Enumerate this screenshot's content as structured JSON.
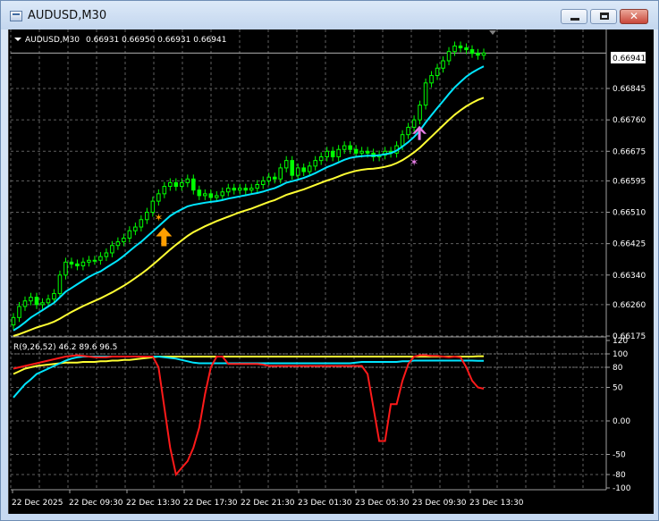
{
  "window": {
    "title": "AUDUSD,M30",
    "icon": "chart-window-icon"
  },
  "chart_header": {
    "symbol_label": "AUDUSD,M30",
    "ohlc_text": "0.66931 0.66950 0.66931 0.66941"
  },
  "indicator_label": "R(9,26,52) 46.2 89.6 96.5",
  "current_price_label": "0.66941",
  "colors": {
    "background": "#000000",
    "grid": "#606060",
    "bull_candle": "#00ff00",
    "fast_ma": "#00e5ff",
    "slow_ma": "#ffff33",
    "osc_red": "#ff1a1a",
    "osc_cyan": "#00e5ff",
    "osc_yellow": "#ffff33",
    "buy_arrow_orange": "#ff9f00",
    "buy_arrow_violet": "#e67ee6"
  },
  "chart_data": [
    {
      "type": "candlestick",
      "ylim": [
        0.66175,
        0.66995
      ],
      "price_ticks": [
        "0.66845",
        "0.66760",
        "0.66675",
        "0.66595",
        "0.66510",
        "0.66425",
        "0.66340",
        "0.66260",
        "0.66175"
      ],
      "price_tick_values": [
        0.66845,
        0.6676,
        0.66675,
        0.66595,
        0.6651,
        0.66425,
        0.6634,
        0.6626,
        0.66175
      ],
      "last_price": 0.66941,
      "time_labels": [
        "22 Dec 2025",
        "22 Dec 09:30",
        "22 Dec 13:30",
        "22 Dec 17:30",
        "22 Dec 21:30",
        "23 Dec 01:30",
        "23 Dec 05:30",
        "23 Dec 09:30",
        "23 Dec 13:30"
      ],
      "closes": [
        0.66225,
        0.66255,
        0.6627,
        0.6628,
        0.6626,
        0.66265,
        0.66275,
        0.6629,
        0.6634,
        0.66375,
        0.6637,
        0.66365,
        0.66375,
        0.6638,
        0.6638,
        0.6639,
        0.664,
        0.6642,
        0.6643,
        0.6644,
        0.6646,
        0.6647,
        0.6649,
        0.6651,
        0.6654,
        0.6656,
        0.6658,
        0.6659,
        0.6658,
        0.6659,
        0.666,
        0.6657,
        0.66555,
        0.6656,
        0.6655,
        0.66555,
        0.66565,
        0.66575,
        0.6657,
        0.66575,
        0.6657,
        0.66575,
        0.66585,
        0.66595,
        0.66605,
        0.666,
        0.6663,
        0.6665,
        0.6661,
        0.6663,
        0.6662,
        0.66635,
        0.6665,
        0.6666,
        0.66675,
        0.6666,
        0.6668,
        0.6669,
        0.6668,
        0.6667,
        0.66675,
        0.6667,
        0.6666,
        0.66665,
        0.66675,
        0.6667,
        0.6669,
        0.6672,
        0.6674,
        0.6676,
        0.668,
        0.6686,
        0.6688,
        0.669,
        0.6692,
        0.66945,
        0.6696,
        0.66955,
        0.6695,
        0.6694,
        0.66935,
        0.66941
      ],
      "fast_ma": [
        0.6619,
        0.662,
        0.66212,
        0.66225,
        0.66235,
        0.66245,
        0.66255,
        0.66265,
        0.6628,
        0.66295,
        0.66305,
        0.66315,
        0.66325,
        0.66335,
        0.66343,
        0.6635,
        0.6636,
        0.6637,
        0.6638,
        0.66392,
        0.66405,
        0.66418,
        0.6643,
        0.66444,
        0.66458,
        0.66472,
        0.66486,
        0.665,
        0.6651,
        0.66518,
        0.66526,
        0.6653,
        0.66533,
        0.66536,
        0.66538,
        0.6654,
        0.66543,
        0.66547,
        0.6655,
        0.66553,
        0.66556,
        0.66559,
        0.66562,
        0.66566,
        0.66571,
        0.66575,
        0.66582,
        0.6659,
        0.66594,
        0.66598,
        0.66603,
        0.66609,
        0.66616,
        0.66624,
        0.66632,
        0.66638,
        0.66645,
        0.66652,
        0.66657,
        0.6666,
        0.66662,
        0.66663,
        0.66663,
        0.66664,
        0.66667,
        0.6667,
        0.66677,
        0.66688,
        0.667,
        0.66714,
        0.66731,
        0.66753,
        0.66773,
        0.66792,
        0.66811,
        0.6683,
        0.66848,
        0.66863,
        0.66877,
        0.66888,
        0.66897,
        0.66905
      ],
      "slow_ma": [
        0.66175,
        0.6618,
        0.66186,
        0.66192,
        0.66198,
        0.66203,
        0.66208,
        0.66214,
        0.66222,
        0.66231,
        0.6624,
        0.66248,
        0.66256,
        0.66263,
        0.6627,
        0.66277,
        0.66285,
        0.66293,
        0.66302,
        0.66311,
        0.66321,
        0.66332,
        0.66343,
        0.66355,
        0.66368,
        0.66381,
        0.66395,
        0.66409,
        0.66422,
        0.66434,
        0.66446,
        0.66456,
        0.66464,
        0.66472,
        0.66479,
        0.66486,
        0.66492,
        0.66498,
        0.66504,
        0.6651,
        0.66515,
        0.6652,
        0.66526,
        0.66532,
        0.66538,
        0.66543,
        0.6655,
        0.66557,
        0.66562,
        0.66567,
        0.66572,
        0.66578,
        0.66584,
        0.6659,
        0.66596,
        0.66601,
        0.66607,
        0.66613,
        0.66618,
        0.66622,
        0.66625,
        0.66627,
        0.66628,
        0.6663,
        0.66633,
        0.66637,
        0.66643,
        0.66651,
        0.66661,
        0.66672,
        0.66685,
        0.667,
        0.66715,
        0.6673,
        0.66745,
        0.6676,
        0.66774,
        0.66786,
        0.66797,
        0.66806,
        0.66814,
        0.6682
      ],
      "signals": [
        {
          "bar": 25,
          "price": 0.6644,
          "kind": "buy-arrow",
          "color": "orange"
        },
        {
          "bar": 69,
          "price": 0.6672,
          "kind": "buy-arrow",
          "color": "violet"
        }
      ],
      "star_markers": [
        {
          "bar": 25,
          "price": 0.66495
        },
        {
          "bar": 69,
          "price": 0.66645
        }
      ]
    },
    {
      "type": "line",
      "name": "R(9,26,52)",
      "ylim": [
        -100,
        120
      ],
      "y_ticks": [
        "120",
        "100",
        "80",
        "50",
        "0.00",
        "-50",
        "-80",
        "-100"
      ],
      "y_tick_values": [
        120,
        100,
        80,
        50,
        0,
        -50,
        -80,
        -100
      ],
      "levels": [
        100,
        80
      ],
      "red_series": [
        78,
        80,
        82,
        84,
        86,
        88,
        90,
        92,
        94,
        96,
        97,
        98,
        97,
        96,
        95,
        95,
        95,
        96,
        96,
        96,
        96,
        96,
        96,
        96,
        96,
        80,
        20,
        -40,
        -80,
        -70,
        -60,
        -40,
        -10,
        40,
        80,
        96,
        96,
        85,
        85,
        85,
        85,
        85,
        85,
        84,
        82,
        82,
        82,
        82,
        82,
        82,
        82,
        82,
        82,
        82,
        82,
        82,
        82,
        82,
        82,
        82,
        82,
        70,
        20,
        -30,
        -30,
        25,
        25,
        60,
        85,
        96,
        98,
        98,
        97,
        97,
        96,
        95,
        96,
        95,
        80,
        60,
        50,
        48
      ],
      "cyan_series": [
        35,
        45,
        55,
        62,
        70,
        74,
        78,
        82,
        86,
        90,
        93,
        95,
        96,
        96,
        96,
        96,
        96,
        96,
        96,
        96,
        96,
        96,
        96,
        96,
        96,
        96,
        95,
        94,
        93,
        91,
        89,
        87,
        86,
        86,
        86,
        86,
        86,
        86,
        86,
        86,
        86,
        86,
        86,
        86,
        86,
        86,
        86,
        86,
        86,
        86,
        86,
        86,
        86,
        86,
        86,
        86,
        86,
        86,
        86,
        87,
        88,
        88,
        88,
        88,
        88,
        88,
        88,
        89,
        89,
        90,
        90,
        90,
        90,
        90,
        90,
        90,
        90,
        90,
        90,
        90,
        89.6,
        89.6
      ],
      "yellow_series": [
        70,
        74,
        78,
        80,
        82,
        83,
        84,
        85,
        86,
        87,
        87,
        87,
        88,
        88,
        88,
        89,
        89,
        90,
        90,
        91,
        91,
        92,
        93,
        94,
        95,
        96,
        96,
        96,
        96,
        96,
        96,
        96,
        96,
        96,
        96,
        96,
        96,
        96,
        96,
        96,
        96,
        96,
        96,
        96,
        96,
        96,
        96,
        96,
        96,
        96,
        96,
        96,
        96,
        96,
        96,
        96,
        96,
        96,
        96,
        96,
        96,
        96,
        96,
        96,
        96,
        96,
        96,
        96,
        96,
        96,
        96,
        96,
        96,
        96,
        96,
        96,
        96,
        96,
        96,
        96,
        96.5,
        96.5
      ]
    }
  ]
}
